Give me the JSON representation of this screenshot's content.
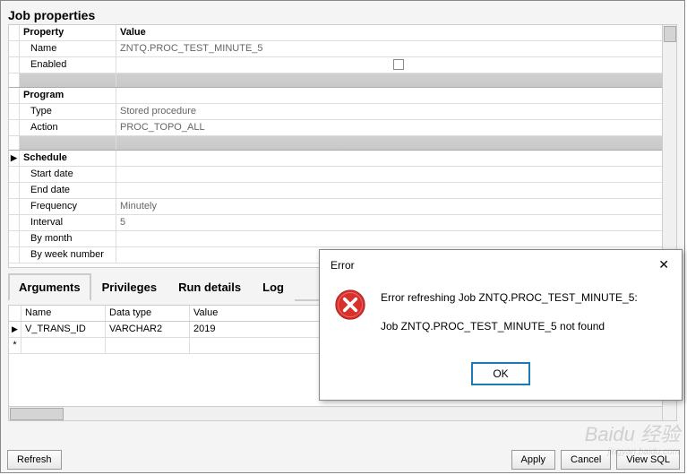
{
  "title": "Job properties",
  "grid": {
    "header": {
      "prop": "Property",
      "val": "Value"
    },
    "name": {
      "label": "Name",
      "value": "ZNTQ.PROC_TEST_MINUTE_5"
    },
    "enabled": {
      "label": "Enabled"
    },
    "program_section": "Program",
    "type": {
      "label": "Type",
      "value": "Stored procedure"
    },
    "action": {
      "label": "Action",
      "value": "PROC_TOPO_ALL"
    },
    "schedule_section": "Schedule",
    "startdate": {
      "label": "Start date",
      "value": ""
    },
    "enddate": {
      "label": "End date",
      "value": ""
    },
    "frequency": {
      "label": "Frequency",
      "value": "Minutely"
    },
    "interval": {
      "label": "Interval",
      "value": "5"
    },
    "bymonth": {
      "label": "By month",
      "value": ""
    },
    "byweeknumber": {
      "label": "By week number",
      "value": ""
    }
  },
  "tabs": {
    "arguments": "Arguments",
    "privileges": "Privileges",
    "rundetails": "Run details",
    "log": "Log"
  },
  "args": {
    "header": {
      "name": "Name",
      "datatype": "Data type",
      "value": "Value"
    },
    "rows": [
      {
        "name": "V_TRANS_ID",
        "datatype": "VARCHAR2",
        "value": "2019"
      }
    ]
  },
  "buttons": {
    "refresh": "Refresh",
    "apply": "Apply",
    "cancel": "Cancel",
    "viewsql": "View SQL"
  },
  "dialog": {
    "title": "Error",
    "line1": "Error refreshing Job ZNTQ.PROC_TEST_MINUTE_5:",
    "line2": "Job ZNTQ.PROC_TEST_MINUTE_5 not found",
    "ok": "OK"
  },
  "watermark": {
    "brand": "Baidu 经验",
    "sub": "jingyan.baidu.com"
  }
}
